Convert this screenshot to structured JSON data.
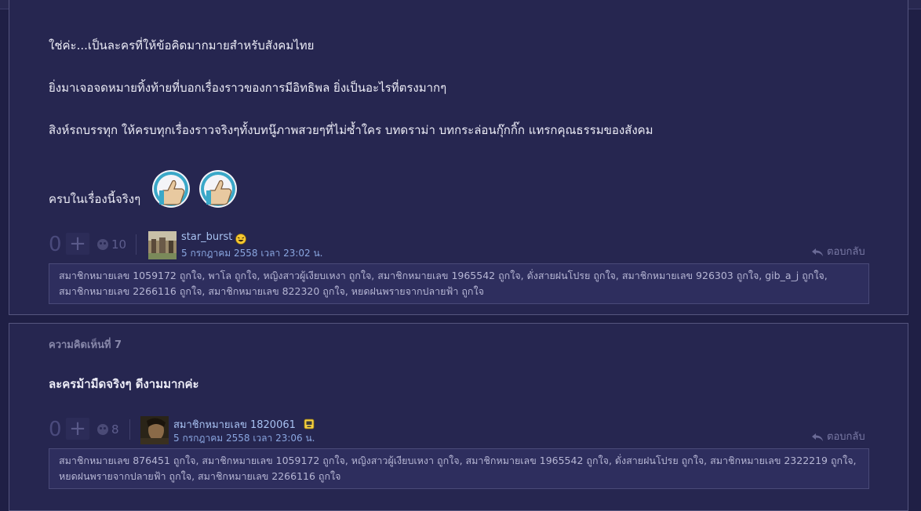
{
  "colors": {
    "page_bg": "#1f1f45",
    "card_bg": "#262650",
    "link": "#a8c2f2",
    "muted": "#7a7aa6"
  },
  "comment6": {
    "lines": [
      "ใช่ค่ะ...เป็นละครที่ให้ข้อคิดมากมายสำหรับสังคมไทย",
      "ยิ่งมาเจอจดหมายทิ้งท้ายที่บอกเรื่องราวของการมีอิทธิพล  ยิ่งเป็นอะไรที่ตรงมากๆ",
      "สิงห์รถบรรทุก ให้ครบทุกเรื่องราวจริงๆทั้งบทนู๊ภาพสวยๆที่ไม่ซ้ำใคร  บทดราม่า  บทกระล่อนกุ๊กกิ๊ก แทรกคุณธรรมของสังคม",
      "ครบในเรื่องนี้จริงๆ"
    ],
    "emoji_icons": [
      "thumbs-up-icon",
      "thumbs-up-icon"
    ],
    "vote_count": "0",
    "emotion_count": "10",
    "author": "star_burst",
    "author_badge": "laughing-emoji-icon",
    "date": "5 กรกฎาคม 2558 เวลา 23:02 น.",
    "reply_label": "ตอบกลับ",
    "likes_text": "สมาชิกหมายเลข 1059172 ถูกใจ, พาโล ถูกใจ, หญิงสาวผู้เงียบเหงา ถูกใจ, สมาชิกหมายเลข 1965542 ถูกใจ, ดั่งสายฝนโปรย ถูกใจ, สมาชิกหมายเลข 926303 ถูกใจ, gib_a_j ถูกใจ, สมาชิกหมายเลข 2266116 ถูกใจ, สมาชิกหมายเลข 822320 ถูกใจ, หยดฝนพรายจากปลายฟ้า ถูกใจ"
  },
  "comment7": {
    "section_label": "ความคิดเห็นที่ 7",
    "text": "ละครม้ามืดจริงๆ ดีงามมากค่ะ",
    "vote_count": "0",
    "emotion_count": "8",
    "author": "สมาชิกหมายเลข 1820061",
    "author_badge": "pantip-member-icon",
    "date": "5 กรกฎาคม 2558 เวลา 23:06 น.",
    "reply_label": "ตอบกลับ",
    "likes_text": "สมาชิกหมายเลข 876451 ถูกใจ, สมาชิกหมายเลข 1059172 ถูกใจ, หญิงสาวผู้เงียบเหงา ถูกใจ, สมาชิกหมายเลข 1965542 ถูกใจ, ดั่งสายฝนโปรย ถูกใจ, สมาชิกหมายเลข 2322219 ถูกใจ, หยดฝนพรายจากปลายฟ้า ถูกใจ, สมาชิกหมายเลข 2266116 ถูกใจ"
  }
}
